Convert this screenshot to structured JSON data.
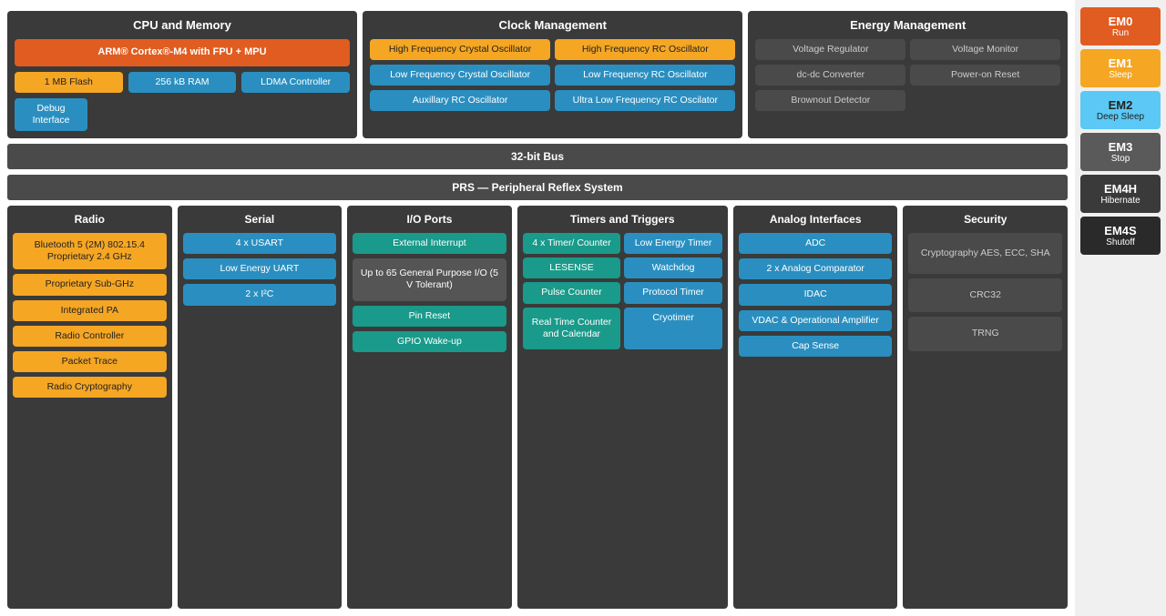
{
  "sidebar": {
    "items": [
      {
        "id": "em0",
        "label": "EM0",
        "sub": "Run",
        "class": "em0"
      },
      {
        "id": "em1",
        "label": "EM1",
        "sub": "Sleep",
        "class": "em1"
      },
      {
        "id": "em2",
        "label": "EM2",
        "sub": "Deep Sleep",
        "class": "em2"
      },
      {
        "id": "em3",
        "label": "EM3",
        "sub": "Stop",
        "class": "em3"
      },
      {
        "id": "em4h",
        "label": "EM4H",
        "sub": "Hibernate",
        "class": "em4h"
      },
      {
        "id": "em4s",
        "label": "EM4S",
        "sub": "Shutoff",
        "class": "em4s"
      }
    ]
  },
  "top": {
    "cpu": {
      "title": "CPU and Memory",
      "arm": "ARM® Cortex®-M4 with FPU + MPU",
      "flash": "1 MB Flash",
      "ram": "256 kB RAM",
      "ldma": "LDMA Controller",
      "debug": "Debug Interface"
    },
    "clock": {
      "title": "Clock Management",
      "hfxo": "High Frequency Crystal Oscillator",
      "hfrco": "High Frequency RC Oscillator",
      "lfxo": "Low Frequency Crystal Oscillator",
      "lfrco": "Low Frequency RC Oscillator",
      "auxrc": "Auxillary RC Oscillator",
      "ulfrco": "Ultra Low Frequency RC Oscilator"
    },
    "energy": {
      "title": "Energy Management",
      "vreg": "Voltage Regulator",
      "vmon": "Voltage Monitor",
      "dcdc": "dc-dc Converter",
      "por": "Power-on Reset",
      "bod": "Brownout Detector"
    }
  },
  "buses": {
    "bus32": "32-bit Bus",
    "prs": "PRS — Peripheral Reflex System"
  },
  "bottom": {
    "radio": {
      "title": "Radio",
      "items": [
        "Bluetooth 5 (2M) 802.15.4 Proprietary 2.4 GHz",
        "Proprietary Sub-GHz",
        "Integrated PA",
        "Radio Controller",
        "Packet Trace",
        "Radio Cryptography"
      ]
    },
    "serial": {
      "title": "Serial",
      "items": [
        "4 x USART",
        "Low Energy UART",
        "2 x I²C"
      ]
    },
    "io": {
      "title": "I/O Ports",
      "items": [
        "External Interrupt",
        "Up to 65 General Purpose I/O (5 V Tolerant)",
        "Pin Reset",
        "GPIO Wake-up"
      ]
    },
    "timers": {
      "title": "Timers and Triggers",
      "left": [
        "4 x Timer/ Counter",
        "LESENSE",
        "Pulse Counter",
        "Real Time Counter and Calendar"
      ],
      "right": [
        "Low Energy Timer",
        "Watchdog",
        "Protocol Timer",
        "Cryotimer"
      ]
    },
    "analog": {
      "title": "Analog Interfaces",
      "items": [
        "ADC",
        "2 x Analog Comparator",
        "IDAC",
        "VDAC & Operational Amplifier",
        "Cap Sense"
      ]
    },
    "security": {
      "title": "Security",
      "items": [
        "Cryptography AES, ECC, SHA",
        "CRC32",
        "TRNG"
      ]
    }
  }
}
